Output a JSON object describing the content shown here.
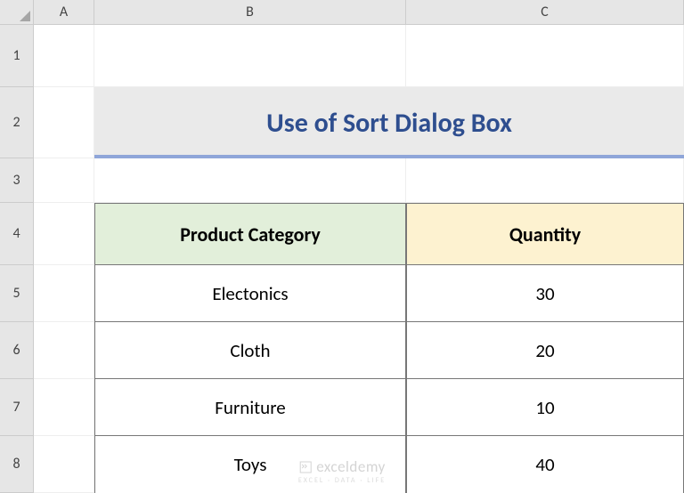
{
  "columns": {
    "A": "A",
    "B": "B",
    "C": "C"
  },
  "rows": {
    "1": "1",
    "2": "2",
    "3": "3",
    "4": "4",
    "5": "5",
    "6": "6",
    "7": "7",
    "8": "8"
  },
  "title": "Use of Sort Dialog Box",
  "headers": {
    "category": "Product Category",
    "quantity": "Quantity"
  },
  "data": [
    {
      "category": "Electonics",
      "quantity": "30"
    },
    {
      "category": "Cloth",
      "quantity": "20"
    },
    {
      "category": "Furniture",
      "quantity": "10"
    },
    {
      "category": "Toys",
      "quantity": "40"
    }
  ],
  "watermark": {
    "main": "exceldemy",
    "sub": "EXCEL · DATA · LIFE"
  }
}
